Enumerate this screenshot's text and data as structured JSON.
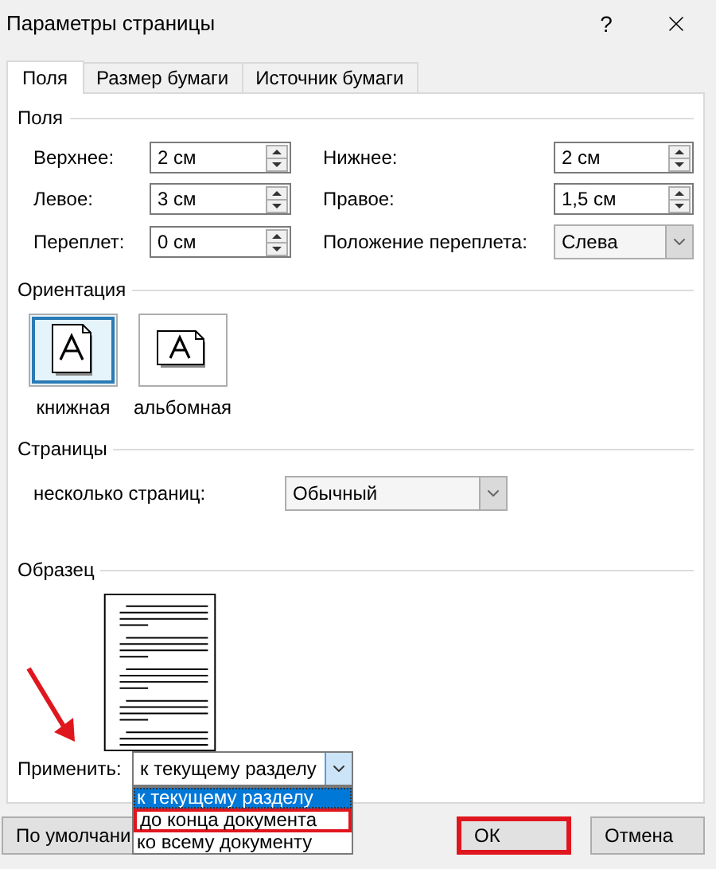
{
  "window": {
    "title": "Параметры страницы",
    "help": "?"
  },
  "tabs": [
    {
      "label": "Поля",
      "selected": true
    },
    {
      "label": "Размер бумаги",
      "selected": false
    },
    {
      "label": "Источник бумаги",
      "selected": false
    }
  ],
  "margins": {
    "heading": "Поля",
    "fields": [
      {
        "label": "Верхнее:",
        "value": "2 см",
        "kind": "spin"
      },
      {
        "label": "Нижнее:",
        "value": "2 см",
        "kind": "spin"
      },
      {
        "label": "Левое:",
        "value": "3 см",
        "kind": "spin"
      },
      {
        "label": "Правое:",
        "value": "1,5 см",
        "kind": "spin"
      },
      {
        "label": "Переплет:",
        "value": "0 см",
        "kind": "spin"
      },
      {
        "label": "Положение переплета:",
        "value": "Слева",
        "kind": "select"
      }
    ]
  },
  "orientation": {
    "heading": "Ориентация",
    "options": [
      {
        "label": "книжная",
        "kind": "portrait",
        "selected": true
      },
      {
        "label": "альбомная",
        "kind": "landscape",
        "selected": false
      }
    ]
  },
  "pages": {
    "heading": "Страницы",
    "label": "несколько страниц:",
    "value": "Обычный"
  },
  "preview": {
    "heading": "Образец"
  },
  "apply": {
    "label": "Применить:",
    "value": "к текущему разделу",
    "options": [
      {
        "label": "к текущему разделу",
        "selected": true,
        "highlighted": false
      },
      {
        "label": "до конца документа",
        "selected": false,
        "highlighted": true
      },
      {
        "label": "ко всему документу",
        "selected": false,
        "highlighted": false
      }
    ]
  },
  "buttons": [
    {
      "label": "По умолчани",
      "kind": "default",
      "highlighted": false
    },
    {
      "label": "ОК",
      "kind": "ok",
      "highlighted": true
    },
    {
      "label": "Отмена",
      "kind": "cancel",
      "highlighted": false
    }
  ]
}
